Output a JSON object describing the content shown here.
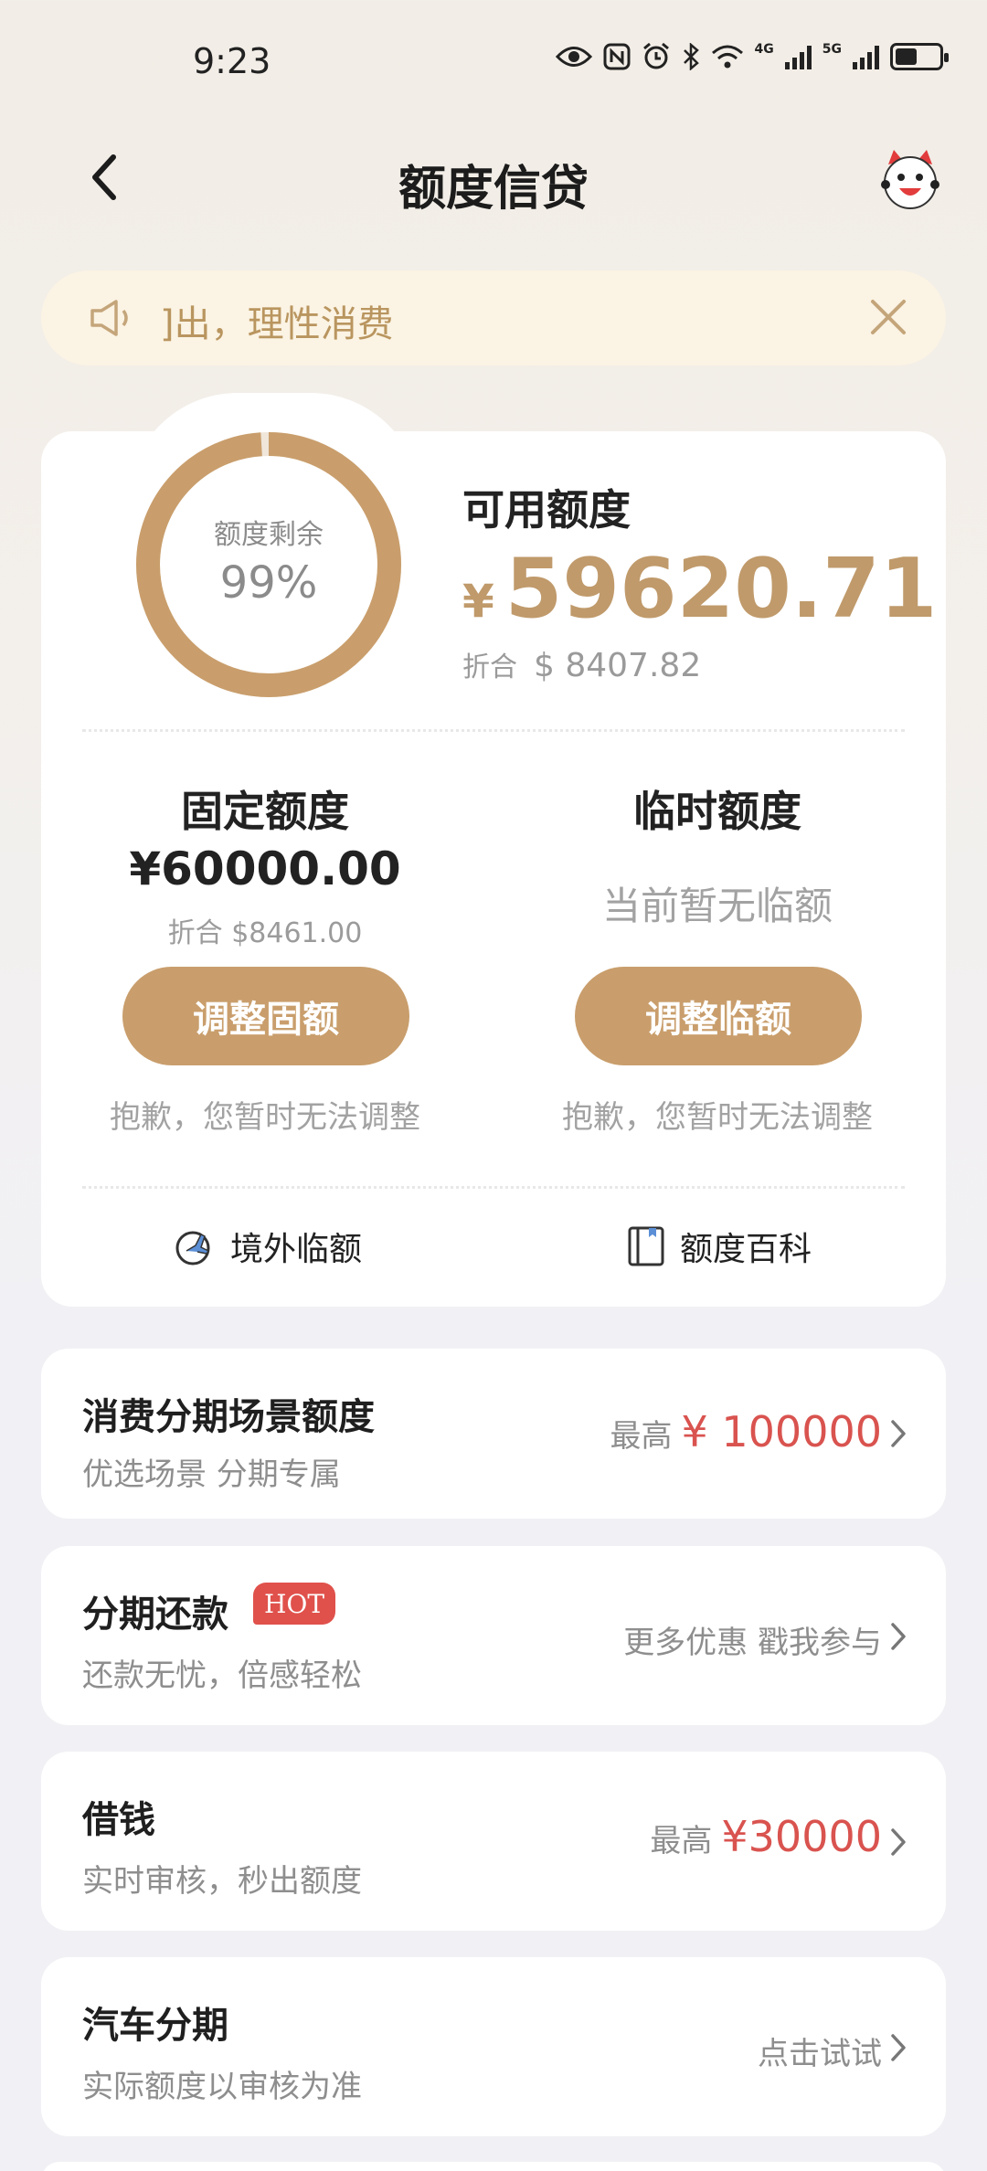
{
  "status_bar": {
    "time": "9:23",
    "net1": "4G",
    "net2": "5G",
    "battery_level": 0.5
  },
  "header": {
    "title": "额度信贷"
  },
  "notice": {
    "text": "]出，理性消费"
  },
  "summary": {
    "ring_label": "额度剩余",
    "ring_value": "99%",
    "ring_percent": 99,
    "available_label": "可用额度",
    "currency_symbol": "¥",
    "available_amount": "59620.71",
    "converted_label": "折合",
    "converted_amount": "$ 8407.82"
  },
  "fixed": {
    "title": "固定额度",
    "amount": "¥60000.00",
    "converted": "折合 $8461.00",
    "button": "调整固额",
    "note": "抱歉，您暂时无法调整"
  },
  "temporary": {
    "title": "临时额度",
    "status": "当前暂无临额",
    "button": "调整临额",
    "note": "抱歉，您暂时无法调整"
  },
  "links": {
    "overseas": "境外临额",
    "wiki": "额度百科"
  },
  "cards": [
    {
      "title": "消费分期场景额度",
      "subtitle": "优选场景 分期专属",
      "prefix": "最高",
      "value": "¥ 100000"
    },
    {
      "title": "分期还款",
      "badge": "HOT",
      "subtitle": "还款无忧，倍感轻松",
      "value": "更多优惠 戳我参与"
    },
    {
      "title": "借钱",
      "subtitle": "实时审核，秒出额度",
      "prefix": "最高",
      "value": "¥30000"
    },
    {
      "title": "汽车分期",
      "subtitle": "实际额度以审核为准",
      "value": "点击试试"
    }
  ],
  "colors": {
    "gold": "#c99e6c",
    "red": "#d9534f"
  }
}
